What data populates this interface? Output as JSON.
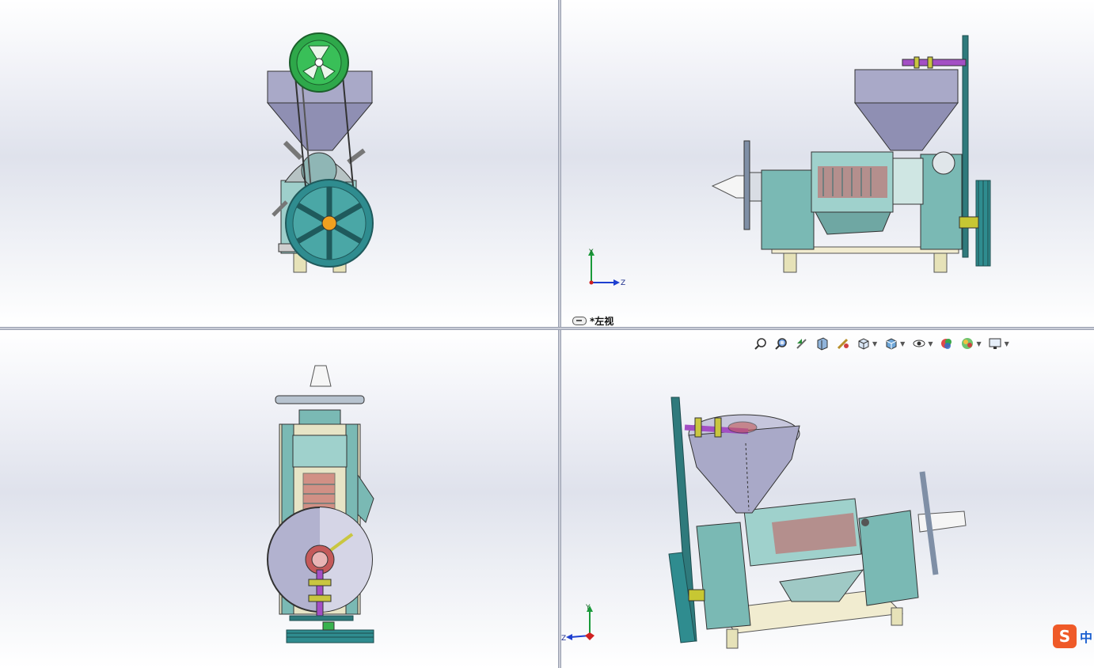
{
  "views": {
    "top_left": {
      "name": "front-view"
    },
    "top_right": {
      "name": "left-view",
      "label": "*左视"
    },
    "bottom_left": {
      "name": "top-view"
    },
    "bottom_right": {
      "name": "isometric-view"
    }
  },
  "triads": {
    "top_right": {
      "axis_y": "Y",
      "axis_x": "Z"
    },
    "bottom_right": {
      "axis_y": "Y",
      "axis_x": "Z"
    }
  },
  "heads_up_toolbar": {
    "items": [
      {
        "icon": "zoom-to-fit-icon",
        "dropdown": false
      },
      {
        "icon": "zoom-to-area-icon",
        "dropdown": false
      },
      {
        "icon": "previous-view-icon",
        "dropdown": false
      },
      {
        "icon": "section-view-icon",
        "dropdown": false
      },
      {
        "icon": "dynamic-annotation-views-icon",
        "dropdown": false
      },
      {
        "icon": "view-orientation-icon",
        "dropdown": true
      },
      {
        "icon": "display-style-icon",
        "dropdown": true
      },
      {
        "icon": "hide-show-items-icon",
        "dropdown": true
      },
      {
        "icon": "edit-appearance-icon",
        "dropdown": false
      },
      {
        "icon": "apply-scene-icon",
        "dropdown": true
      },
      {
        "icon": "view-settings-icon",
        "dropdown": true
      }
    ]
  },
  "ime": {
    "logo": "S",
    "text": "中"
  },
  "colors": {
    "teal_body": "#6fb3ad",
    "teal_dark": "#2f8c8f",
    "hopper": "#a9a9c8",
    "pulley_green": "#2ea84a",
    "leg": "#e6e2b8",
    "accent_red": "#c45a5a",
    "ime_orange": "#ef5a28"
  }
}
